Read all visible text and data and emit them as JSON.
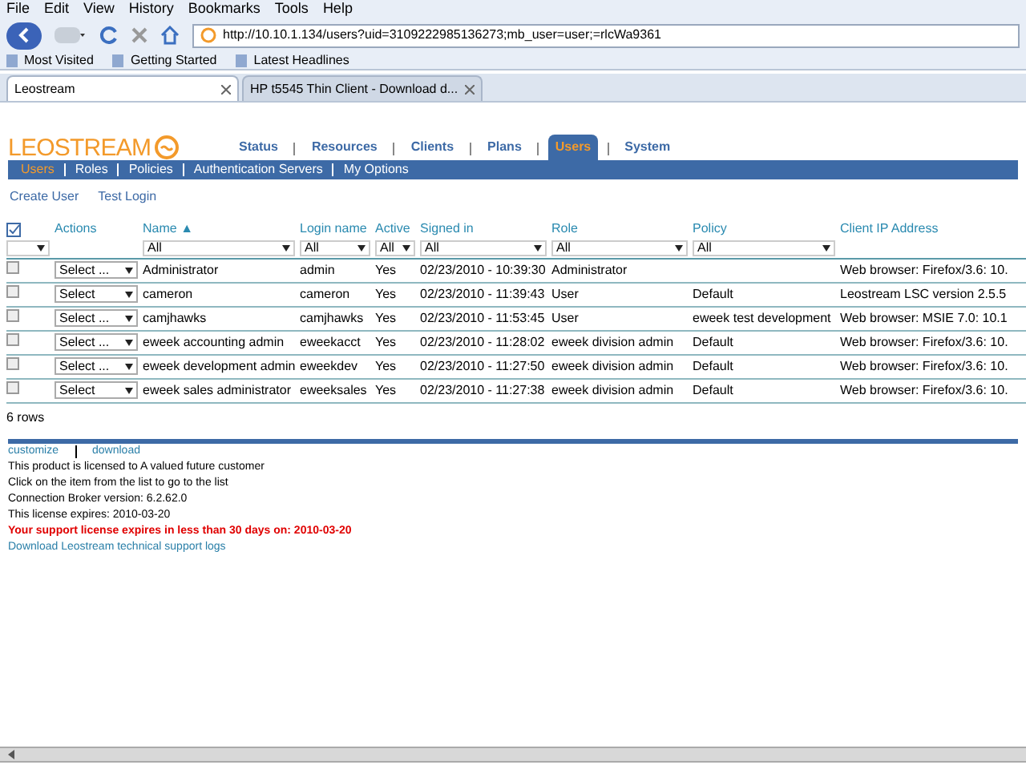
{
  "menu": [
    "File",
    "Edit",
    "View",
    "History",
    "Bookmarks",
    "Tools",
    "Help"
  ],
  "address": "http://10.10.1.134/users?uid=3109222985136273;mb_user=user;=rlcWa9361",
  "bookmarks": [
    "Most Visited",
    "Getting Started",
    "Latest Headlines"
  ],
  "browser_tabs": [
    {
      "label": "Leostream",
      "selected": true
    },
    {
      "label": "HP t5545 Thin Client - Download d...",
      "selected": false
    }
  ],
  "logo": "LEOSTREAM",
  "nav": [
    {
      "label": "Status",
      "selected": false
    },
    {
      "label": "Resources",
      "selected": false
    },
    {
      "label": "Clients",
      "selected": false
    },
    {
      "label": "Plans",
      "selected": false
    },
    {
      "label": "Users",
      "selected": true
    },
    {
      "label": "System",
      "selected": false
    }
  ],
  "subnav": [
    {
      "label": "Users",
      "selected": true
    },
    {
      "label": "Roles",
      "selected": false
    },
    {
      "label": "Policies",
      "selected": false
    },
    {
      "label": "Authentication Servers",
      "selected": false
    },
    {
      "label": "My Options",
      "selected": false
    }
  ],
  "links": [
    "Create User",
    "Test Login"
  ],
  "table": {
    "columns": [
      "Actions",
      "Name ▲",
      "Login name",
      "Active",
      "Signed in",
      "Role",
      "Policy",
      "Client IP Address"
    ],
    "filters": [
      "All",
      "All",
      "All",
      "All",
      "All",
      "All"
    ],
    "rows": [
      {
        "checked": false,
        "cells": [
          "Select ...",
          "Administrator",
          "admin",
          "Yes",
          "02/23/2010 - 10:39:30",
          "Administrator",
          "",
          "Web browser: Firefox/3.6: 10."
        ]
      },
      {
        "checked": false,
        "cells": [
          "Select",
          "cameron",
          "cameron",
          "Yes",
          "02/23/2010 - 11:39:43",
          "User",
          "Default",
          "Leostream LSC version 2.5.5"
        ]
      },
      {
        "checked": false,
        "cells": [
          "Select ...",
          "camjhawks",
          "camjhawks",
          "Yes",
          "02/23/2010 - 11:53:45",
          "User",
          "eweek test development",
          "Web browser: MSIE 7.0: 10.1"
        ]
      },
      {
        "checked": false,
        "cells": [
          "Select ...",
          "eweek accounting admin",
          "eweekacct",
          "Yes",
          "02/23/2010 - 11:28:02",
          "eweek division admin",
          "Default",
          "Web browser: Firefox/3.6: 10."
        ]
      },
      {
        "checked": false,
        "cells": [
          "Select ...",
          "eweek development admin",
          "eweekdev",
          "Yes",
          "02/23/2010 - 11:27:50",
          "eweek division admin",
          "Default",
          "Web browser: Firefox/3.6: 10."
        ]
      },
      {
        "checked": false,
        "cells": [
          "Select",
          "eweek sales administrator",
          "eweeksales",
          "Yes",
          "02/23/2010 - 11:27:38",
          "eweek division admin",
          "Default",
          "Web browser: Firefox/3.6: 10."
        ]
      }
    ],
    "count": "6 rows"
  },
  "footer_links": [
    "customize",
    "download"
  ],
  "footer": [
    {
      "kind": "text",
      "text": "This product is licensed to A valued future customer"
    },
    {
      "kind": "text",
      "text": "Click on the item from the list to go to the list"
    },
    {
      "kind": "text",
      "text": "Connection Broker version: 6.2.62.0"
    },
    {
      "kind": "text",
      "text": "This license expires: 2010-03-20"
    },
    {
      "kind": "warning",
      "text": "Your support license expires in less than 30 days on: 2010-03-20"
    },
    {
      "kind": "link",
      "text": "Download Leostream technical support logs"
    }
  ]
}
